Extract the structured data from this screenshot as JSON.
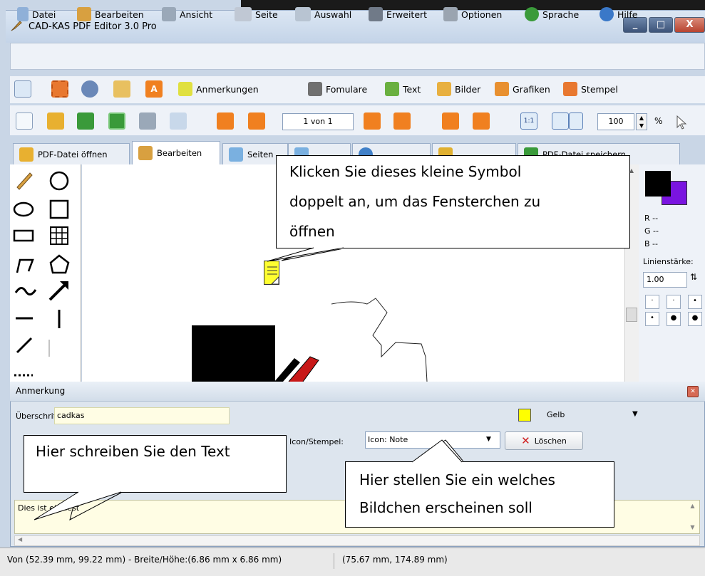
{
  "window": {
    "title": "CAD-KAS PDF Editor 3.0 Pro",
    "btn_min": "_",
    "btn_max": "□",
    "btn_close": "X"
  },
  "menu": [
    {
      "label": "Datei",
      "icon": "file-icon",
      "color": "#8fb0d8"
    },
    {
      "label": "Bearbeiten",
      "icon": "brush-icon",
      "color": "#d8a040"
    },
    {
      "label": "Ansicht",
      "icon": "view-icon",
      "color": "#9aa8b8"
    },
    {
      "label": "Seite",
      "icon": "book-icon",
      "color": "#c0c8d4"
    },
    {
      "label": "Auswahl",
      "icon": "lasso-icon",
      "color": "#b8c4d2"
    },
    {
      "label": "Erweitert",
      "icon": "telescope-icon",
      "color": "#707a88"
    },
    {
      "label": "Optionen",
      "icon": "wrench-icon",
      "color": "#9aa4b0"
    },
    {
      "label": "Sprache",
      "icon": "globe-icon",
      "color": "#3a9a3a"
    },
    {
      "label": "Hilfe",
      "icon": "help-icon",
      "color": "#3a78c8"
    }
  ],
  "toolbar1": {
    "anmerkungen": "Anmerkungen",
    "formulare": "Fomulare",
    "text": "Text",
    "bilder": "Bilder",
    "grafiken": "Grafiken",
    "stempel": "Stempel"
  },
  "toolbar2": {
    "page": "1 von 1",
    "zoom_ratio": "1:1",
    "zoom": "100",
    "zoom_unit": "%"
  },
  "tabs": [
    {
      "label": "PDF-Datei öffnen",
      "icon": "open-folder-icon",
      "color": "#e8b030"
    },
    {
      "label": "Bearbeiten",
      "icon": "brush-icon",
      "color": "#d8a040"
    },
    {
      "label": "Seiten",
      "icon": "pages-icon",
      "color": "#7ab0e0"
    },
    {
      "label": "",
      "icon": "doc-icon",
      "color": "#7ab0e0"
    },
    {
      "label": "",
      "icon": "info-icon",
      "color": "#4080c8"
    },
    {
      "label": "",
      "icon": "lock-icon",
      "color": "#e0b030"
    },
    {
      "label": "PDF-Datei speichern",
      "icon": "save-icon",
      "color": "#3a9a3a"
    }
  ],
  "right_panel": {
    "r": "R --",
    "g": "G --",
    "b": "B --",
    "line_width_label": "Linienstärke:",
    "line_width_value": "1.00",
    "fg_color": "#000000",
    "bg_color": "#7a14e0"
  },
  "annotation": {
    "title": "Anmerkung",
    "heading_label": "Überschrift:",
    "heading_value": "cadkas",
    "color_label": "Gelb",
    "color_value": "#ffff00",
    "icon_label": "Icon/Stempel:",
    "icon_value": "Icon: Note",
    "delete_label": "Löschen",
    "text_value": "Dies ist ein Test"
  },
  "status": {
    "left": "Von (52.39 mm, 99.22 mm) - Breite/Höhe:(6.86 mm x 6.86 mm)",
    "right": "(75.67 mm, 174.89 mm)"
  },
  "callouts": {
    "top": [
      "Klicken Sie dieses kleine Symbol",
      "doppelt an, um das Fensterchen zu",
      "öffnen"
    ],
    "left": "Hier schreiben Sie den Text",
    "right": [
      "Hier stellen Sie ein welches",
      "Bildchen erscheinen soll"
    ]
  }
}
